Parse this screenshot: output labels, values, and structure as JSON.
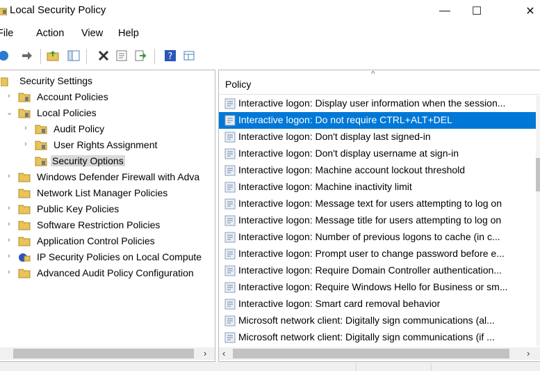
{
  "window": {
    "title": "Local Security Policy",
    "minimize": "—",
    "maximize": "☐",
    "close": "✕"
  },
  "menu": [
    "File",
    "Action",
    "View",
    "Help"
  ],
  "toolbar": [
    "back-icon",
    "forward-icon",
    "up-folder-icon",
    "show-hide-tree-icon",
    "delete-icon",
    "properties-icon",
    "export-list-icon",
    "help-icon",
    "view-icon"
  ],
  "tree": {
    "root": "Security Settings",
    "items": [
      {
        "label": "Account Policies"
      },
      {
        "label": "Local Policies"
      },
      {
        "label": "Audit Policy"
      },
      {
        "label": "User Rights Assignment"
      },
      {
        "label": "Security Options"
      },
      {
        "label": "Windows Defender Firewall with Adva"
      },
      {
        "label": "Network List Manager Policies"
      },
      {
        "label": "Public Key Policies"
      },
      {
        "label": "Software Restriction Policies"
      },
      {
        "label": "Application Control Policies"
      },
      {
        "label": "IP Security Policies on Local Compute"
      },
      {
        "label": "Advanced Audit Policy Configuration"
      }
    ]
  },
  "list": {
    "column": "Policy",
    "rows": [
      "Interactive logon: Display user information when the session...",
      "Interactive logon: Do not require CTRL+ALT+DEL",
      "Interactive logon: Don't display last signed-in",
      "Interactive logon: Don't display username at sign-in",
      "Interactive logon: Machine account lockout threshold",
      "Interactive logon: Machine inactivity limit",
      "Interactive logon: Message text for users attempting to log on",
      "Interactive logon: Message title for users attempting to log on",
      "Interactive logon: Number of previous logons to cache (in c...",
      "Interactive logon: Prompt user to change password before e...",
      "Interactive logon: Require Domain Controller authentication...",
      "Interactive logon: Require Windows Hello for Business or sm...",
      "Interactive logon: Smart card removal behavior",
      "Microsoft network client: Digitally sign communications (al...",
      "Microsoft network client: Digitally sign communications (if ..."
    ],
    "selected_index": 1
  },
  "colors": {
    "selection": "#0078d7",
    "folder": "#e8c45a"
  }
}
